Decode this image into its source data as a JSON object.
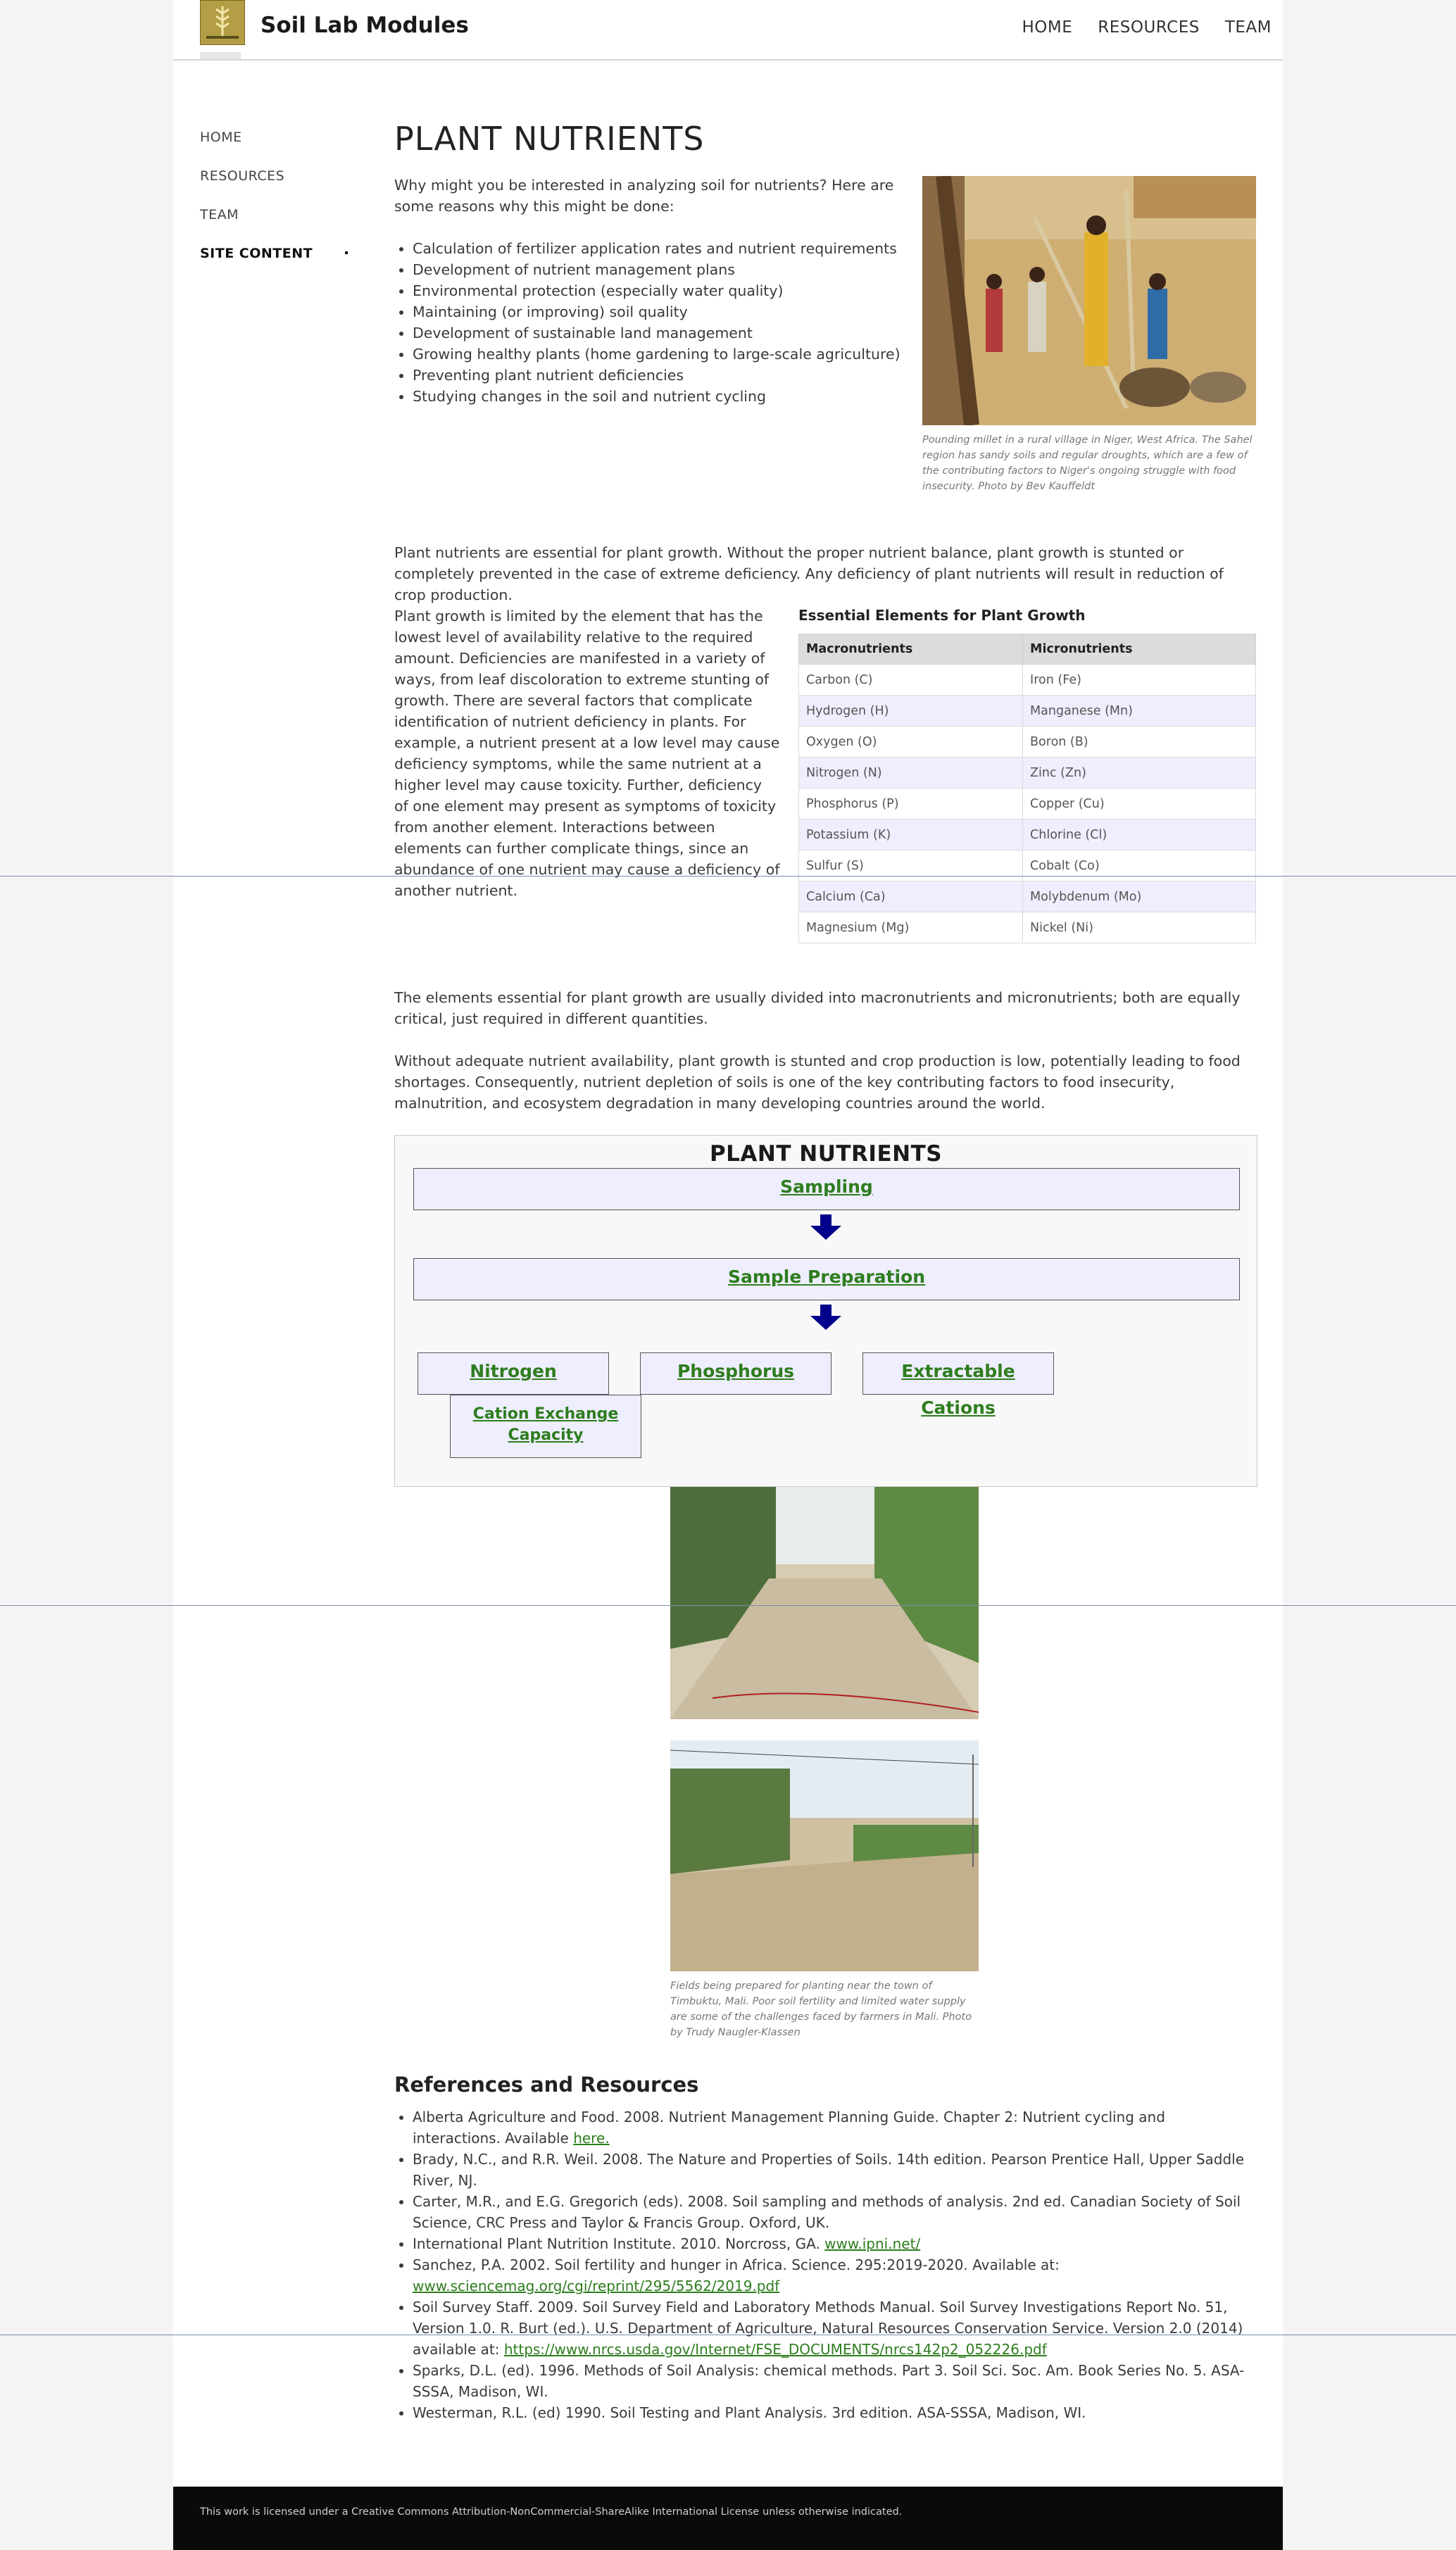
{
  "header": {
    "site_title": "Soil Lab Modules",
    "nav": [
      "HOME",
      "RESOURCES",
      "TEAM"
    ]
  },
  "sidebar": {
    "items": [
      {
        "label": "HOME"
      },
      {
        "label": "RESOURCES"
      },
      {
        "label": "TEAM"
      },
      {
        "label": "SITE CONTENT"
      }
    ]
  },
  "main": {
    "title": "PLANT NUTRIENTS",
    "intro": "Why might you be interested in analyzing soil for nutrients? Here are some reasons why this might be done:",
    "reasons": [
      "Calculation of fertilizer application rates and nutrient requirements",
      "Development of nutrient management plans",
      "Environmental protection (especially water quality)",
      "Maintaining (or improving) soil quality",
      "Development of sustainable land management",
      "Growing healthy plants (home gardening to large-scale agriculture)",
      "Preventing plant nutrient deficiencies",
      "Studying changes in the soil and nutrient cycling"
    ],
    "photo1_caption": "Pounding millet in a rural village in Niger, West Africa. The Sahel region has sandy soils and regular droughts, which are a few of the contributing factors to Niger's ongoing struggle with food insecurity. Photo by Bev Kauffeldt",
    "para2": "Plant nutrients are essential for plant growth. Without the proper nutrient balance, plant growth is stunted or completely prevented in the case of extreme deficiency. Any deficiency of plant nutrients will result in reduction of crop production.",
    "para3": "Plant growth is limited by the element that has the lowest level of availability relative to the required amount. Deficiencies are manifested in a variety of ways, from leaf discoloration to extreme stunting of growth. There are several factors that complicate identification of nutrient deficiency in plants. For example, a nutrient present at a low level may cause deficiency symptoms, while the same nutrient at a higher level may cause toxicity. Further, deficiency of one element may present as symptoms of toxicity from another element. Interactions between elements can further complicate things, since an abundance of one nutrient may cause a deficiency of another nutrient.",
    "elements_title": "Essential Elements for Plant Growth",
    "elements_headers": [
      "Macronutrients",
      "Micronutrients"
    ],
    "elements_rows": [
      [
        "Carbon (C)",
        "Iron (Fe)"
      ],
      [
        "Hydrogen (H)",
        "Manganese (Mn)"
      ],
      [
        "Oxygen (O)",
        "Boron (B)"
      ],
      [
        "Nitrogen (N)",
        "Zinc (Zn)"
      ],
      [
        "Phosphorus (P)",
        "Copper (Cu)"
      ],
      [
        "Potassium (K)",
        "Chlorine (Cl)"
      ],
      [
        "Sulfur (S)",
        "Cobalt (Co)"
      ],
      [
        "Calcium (Ca)",
        "Molybdenum (Mo)"
      ],
      [
        "Magnesium (Mg)",
        "Nickel (Ni)"
      ]
    ],
    "para4": "The elements essential for plant growth are usually divided into macronutrients and micronutrients; both are equally critical, just required in different quantities.",
    "para5": "Without adequate nutrient availability, plant growth is stunted and crop production is low, potentially leading to food shortages. Consequently, nutrient depletion of soils is one of the key contributing factors to food insecurity, malnutrition, and ecosystem degradation in many developing countries around the world.",
    "flow": {
      "title": "PLANT NUTRIENTS",
      "sampling": "Sampling",
      "sample_prep": "Sample Preparation",
      "nitrogen": "Nitrogen",
      "phosphorus": "Phosphorus",
      "cations": "Extractable Cations",
      "cec": "Cation Exchange Capacity"
    },
    "photo2_caption": "Fields being prepared for planting near the town of Timbuktu, Mali. Poor soil fertility and limited water supply are some of the challenges faced by farmers in Mali. Photo by Trudy Naugler-Klassen",
    "refs_title": "References and Resources",
    "refs": [
      {
        "text": "Alberta Agriculture and Food. 2008. Nutrient Management Planning Guide. Chapter 2: Nutrient cycling and interactions. Available ",
        "link": "here."
      },
      {
        "text": "Brady, N.C., and R.R. Weil. 2008. The Nature and Properties of Soils. 14th edition. Pearson Prentice Hall, Upper Saddle River, NJ.",
        "link": ""
      },
      {
        "text": "Carter, M.R., and E.G. Gregorich (eds). 2008. Soil sampling and methods of analysis. 2nd ed. Canadian Society of Soil Science, CRC Press and Taylor & Francis Group. Oxford, UK.",
        "link": ""
      },
      {
        "text": "International Plant Nutrition Institute. 2010. Norcross, GA. ",
        "link": "www.ipni.net/"
      },
      {
        "text": "Sanchez, P.A. 2002. Soil fertility and hunger in Africa. Science. 295:2019-2020. Available at: ",
        "link": "www.sciencemag.org/cgi/reprint/295/5562/2019.pdf"
      },
      {
        "text": "Soil Survey Staff. 2009. Soil Survey Field and Laboratory Methods Manual. Soil Survey Investigations Report No. 51, Version 1.0. R. Burt (ed.). U.S. Department of Agriculture, Natural Resources Conservation Service. Version 2.0 (2014) available at: ",
        "link": "https://www.nrcs.usda.gov/Internet/FSE_DOCUMENTS/nrcs142p2_052226.pdf"
      },
      {
        "text": "Sparks, D.L. (ed). 1996. Methods of Soil Analysis: chemical methods. Part 3. Soil Sci. Soc. Am. Book Series No. 5. ASA-SSSA, Madison, WI.",
        "link": ""
      },
      {
        "text": "Westerman, R.L. (ed) 1990. Soil Testing and Plant Analysis. 3rd edition. ASA-SSSA, Madison, WI.",
        "link": ""
      }
    ]
  },
  "footer": {
    "license": "This work is licensed under a Creative Commons Attribution-NonCommercial-ShareAlike International License unless otherwise indicated."
  },
  "colors": {
    "link_green": "#2e7d1e",
    "flow_box_fill": "#eeeeff",
    "arrow_navy": "#00008b",
    "footer_bg": "#0a0a0a"
  }
}
